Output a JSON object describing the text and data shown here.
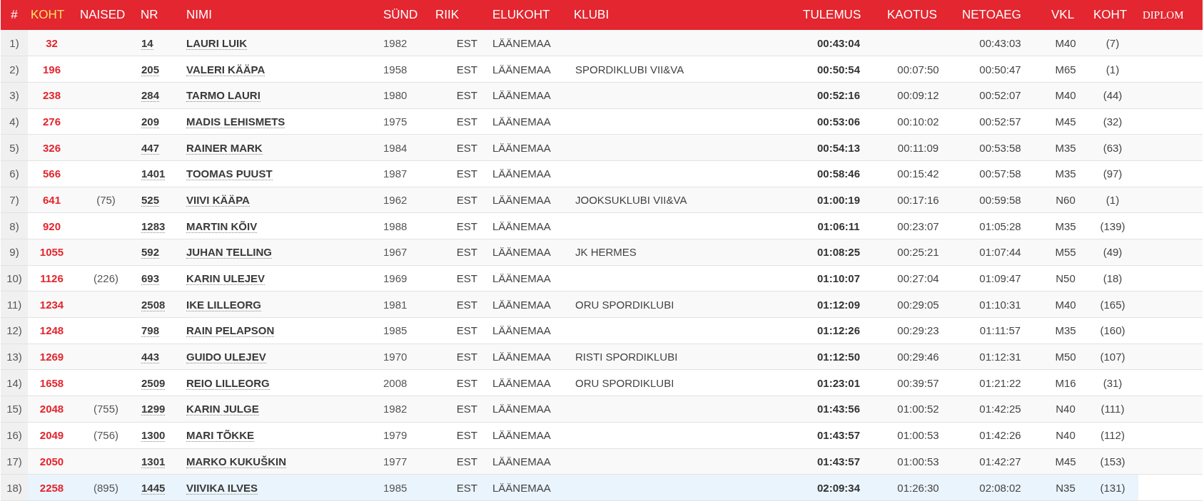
{
  "table": {
    "columns": [
      {
        "label": "#",
        "kind": "plain",
        "selected": false
      },
      {
        "label": "KOHT",
        "kind": "plain",
        "selected": true
      },
      {
        "label": "NAISED",
        "kind": "plain",
        "selected": false
      },
      {
        "label": "NR",
        "kind": "plain",
        "selected": false
      },
      {
        "label": "NIMI",
        "kind": "plain",
        "selected": false
      },
      {
        "label": "SÜND",
        "kind": "plain",
        "selected": false
      },
      {
        "label": "RIIK",
        "kind": "plain",
        "selected": false
      },
      {
        "label": "ELUKOHT",
        "kind": "plain",
        "selected": false
      },
      {
        "label": "KLUBI",
        "kind": "plain",
        "selected": false
      },
      {
        "label": "TULEMUS",
        "kind": "plain",
        "selected": false
      },
      {
        "label": "KAOTUS",
        "kind": "plain",
        "selected": false
      },
      {
        "label": "NETOAEG",
        "kind": "plain",
        "selected": false
      },
      {
        "label": "VKL",
        "kind": "plain",
        "selected": false
      },
      {
        "label": "KOHT",
        "kind": "plain",
        "selected": false
      },
      {
        "label": "DIPLOM",
        "kind": "serif",
        "selected": false
      }
    ],
    "rows": [
      {
        "index": "1)",
        "place": "32",
        "nr": "14",
        "name": "LAURI LUIK",
        "born": "1982",
        "country": "EST",
        "residence": "LÄÄNEMAA",
        "result": "00:43:04",
        "net_time": "00:43:03",
        "age_class": "M40",
        "class_place": "(7)",
        "highlighted": false
      },
      {
        "index": "2)",
        "place": "196",
        "nr": "205",
        "name": "VALERI KÄÄPA",
        "born": "1958",
        "country": "EST",
        "residence": "LÄÄNEMAA",
        "club": "SPORDIKLUBI VII&VA",
        "result": "00:50:54",
        "loss": "00:07:50",
        "net_time": "00:50:47",
        "age_class": "M65",
        "class_place": "(1)",
        "highlighted": false
      },
      {
        "index": "3)",
        "place": "238",
        "nr": "284",
        "name": "TARMO LAURI",
        "born": "1980",
        "country": "EST",
        "residence": "LÄÄNEMAA",
        "result": "00:52:16",
        "loss": "00:09:12",
        "net_time": "00:52:07",
        "age_class": "M40",
        "class_place": "(44)",
        "highlighted": false
      },
      {
        "index": "4)",
        "place": "276",
        "nr": "209",
        "name": "MADIS LEHISMETS",
        "born": "1975",
        "country": "EST",
        "residence": "LÄÄNEMAA",
        "result": "00:53:06",
        "loss": "00:10:02",
        "net_time": "00:52:57",
        "age_class": "M45",
        "class_place": "(32)",
        "highlighted": false
      },
      {
        "index": "5)",
        "place": "326",
        "nr": "447",
        "name": "RAINER MARK",
        "born": "1984",
        "country": "EST",
        "residence": "LÄÄNEMAA",
        "result": "00:54:13",
        "loss": "00:11:09",
        "net_time": "00:53:58",
        "age_class": "M35",
        "class_place": "(63)",
        "highlighted": false
      },
      {
        "index": "6)",
        "place": "566",
        "nr": "1401",
        "name": "TOOMAS PUUST",
        "born": "1987",
        "country": "EST",
        "residence": "LÄÄNEMAA",
        "result": "00:58:46",
        "loss": "00:15:42",
        "net_time": "00:57:58",
        "age_class": "M35",
        "class_place": "(97)",
        "highlighted": false
      },
      {
        "index": "7)",
        "place": "641",
        "women_place": "(75)",
        "nr": "525",
        "name": "VIIVI KÄÄPA",
        "born": "1962",
        "country": "EST",
        "residence": "LÄÄNEMAA",
        "club": "JOOKSUKLUBI VII&VA",
        "result": "01:00:19",
        "loss": "00:17:16",
        "net_time": "00:59:58",
        "age_class": "N60",
        "class_place": "(1)",
        "highlighted": false
      },
      {
        "index": "8)",
        "place": "920",
        "nr": "1283",
        "name": "MARTIN KÕIV",
        "born": "1988",
        "country": "EST",
        "residence": "LÄÄNEMAA",
        "result": "01:06:11",
        "loss": "00:23:07",
        "net_time": "01:05:28",
        "age_class": "M35",
        "class_place": "(139)",
        "highlighted": false
      },
      {
        "index": "9)",
        "place": "1055",
        "nr": "592",
        "name": "JUHAN TELLING",
        "born": "1967",
        "country": "EST",
        "residence": "LÄÄNEMAA",
        "club": "JK HERMES",
        "result": "01:08:25",
        "loss": "00:25:21",
        "net_time": "01:07:44",
        "age_class": "M55",
        "class_place": "(49)",
        "highlighted": false
      },
      {
        "index": "10)",
        "place": "1126",
        "women_place": "(226)",
        "nr": "693",
        "name": "KARIN ULEJEV",
        "born": "1969",
        "country": "EST",
        "residence": "LÄÄNEMAA",
        "result": "01:10:07",
        "loss": "00:27:04",
        "net_time": "01:09:47",
        "age_class": "N50",
        "class_place": "(18)",
        "highlighted": false
      },
      {
        "index": "11)",
        "place": "1234",
        "nr": "2508",
        "name": "IKE LILLEORG",
        "born": "1981",
        "country": "EST",
        "residence": "LÄÄNEMAA",
        "club": "ORU SPORDIKLUBI",
        "result": "01:12:09",
        "loss": "00:29:05",
        "net_time": "01:10:31",
        "age_class": "M40",
        "class_place": "(165)",
        "highlighted": false
      },
      {
        "index": "12)",
        "place": "1248",
        "nr": "798",
        "name": "RAIN PELAPSON",
        "born": "1985",
        "country": "EST",
        "residence": "LÄÄNEMAA",
        "result": "01:12:26",
        "loss": "00:29:23",
        "net_time": "01:11:57",
        "age_class": "M35",
        "class_place": "(160)",
        "highlighted": false
      },
      {
        "index": "13)",
        "place": "1269",
        "nr": "443",
        "name": "GUIDO ULEJEV",
        "born": "1970",
        "country": "EST",
        "residence": "LÄÄNEMAA",
        "club": "RISTI SPORDIKLUBI",
        "result": "01:12:50",
        "loss": "00:29:46",
        "net_time": "01:12:31",
        "age_class": "M50",
        "class_place": "(107)",
        "highlighted": false
      },
      {
        "index": "14)",
        "place": "1658",
        "nr": "2509",
        "name": "REIO LILLEORG",
        "born": "2008",
        "country": "EST",
        "residence": "LÄÄNEMAA",
        "club": "ORU SPORDIKLUBI",
        "result": "01:23:01",
        "loss": "00:39:57",
        "net_time": "01:21:22",
        "age_class": "M16",
        "class_place": "(31)",
        "highlighted": false
      },
      {
        "index": "15)",
        "place": "2048",
        "women_place": "(755)",
        "nr": "1299",
        "name": "KARIN JULGE",
        "born": "1982",
        "country": "EST",
        "residence": "LÄÄNEMAA",
        "result": "01:43:56",
        "loss": "01:00:52",
        "net_time": "01:42:25",
        "age_class": "N40",
        "class_place": "(111)",
        "highlighted": false
      },
      {
        "index": "16)",
        "place": "2049",
        "women_place": "(756)",
        "nr": "1300",
        "name": "MARI TÕKKE",
        "born": "1979",
        "country": "EST",
        "residence": "LÄÄNEMAA",
        "result": "01:43:57",
        "loss": "01:00:53",
        "net_time": "01:42:26",
        "age_class": "N40",
        "class_place": "(112)",
        "highlighted": false
      },
      {
        "index": "17)",
        "place": "2050",
        "nr": "1301",
        "name": "MARKO KUKUŠKIN",
        "born": "1977",
        "country": "EST",
        "residence": "LÄÄNEMAA",
        "result": "01:43:57",
        "loss": "01:00:53",
        "net_time": "01:42:27",
        "age_class": "M45",
        "class_place": "(153)",
        "highlighted": false
      },
      {
        "index": "18)",
        "place": "2258",
        "women_place": "(895)",
        "nr": "1445",
        "name": "VIIVIKA ILVES",
        "born": "1985",
        "country": "EST",
        "residence": "LÄÄNEMAA",
        "result": "02:09:34",
        "loss": "01:26:30",
        "net_time": "02:08:02",
        "age_class": "N35",
        "class_place": "(131)",
        "highlighted": true
      }
    ]
  }
}
